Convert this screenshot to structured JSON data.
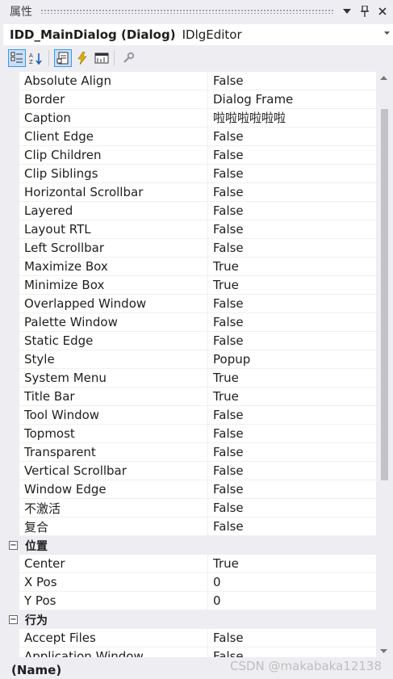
{
  "window": {
    "title": "属性",
    "dropdown_icon": "triangle-down-icon",
    "pin_icon": "pin-icon",
    "close_icon": "close-icon"
  },
  "object_selector": {
    "name": "IDD_MainDialog (Dialog)",
    "type": "IDlgEditor"
  },
  "toolbar": {
    "tools": [
      "categorized-icon",
      "alphabetical-icon",
      "properties-icon",
      "events-icon",
      "messages-icon",
      "property-pages-icon"
    ]
  },
  "groups": [
    {
      "category": null,
      "rows": [
        {
          "name": "Absolute Align",
          "value": "False"
        },
        {
          "name": "Border",
          "value": "Dialog Frame"
        },
        {
          "name": "Caption",
          "value": "啦啦啦啦啦啦"
        },
        {
          "name": "Client Edge",
          "value": "False"
        },
        {
          "name": "Clip Children",
          "value": "False"
        },
        {
          "name": "Clip Siblings",
          "value": "False"
        },
        {
          "name": "Horizontal Scrollbar",
          "value": "False"
        },
        {
          "name": "Layered",
          "value": "False"
        },
        {
          "name": "Layout RTL",
          "value": "False"
        },
        {
          "name": "Left Scrollbar",
          "value": "False"
        },
        {
          "name": "Maximize Box",
          "value": "True"
        },
        {
          "name": "Minimize Box",
          "value": "True"
        },
        {
          "name": "Overlapped Window",
          "value": "False"
        },
        {
          "name": "Palette Window",
          "value": "False"
        },
        {
          "name": "Static Edge",
          "value": "False"
        },
        {
          "name": "Style",
          "value": "Popup"
        },
        {
          "name": "System Menu",
          "value": "True"
        },
        {
          "name": "Title Bar",
          "value": "True"
        },
        {
          "name": "Tool Window",
          "value": "False"
        },
        {
          "name": "Topmost",
          "value": "False"
        },
        {
          "name": "Transparent",
          "value": "False"
        },
        {
          "name": "Vertical Scrollbar",
          "value": "False"
        },
        {
          "name": "Window Edge",
          "value": "False"
        },
        {
          "name": "不激活",
          "value": "False"
        },
        {
          "name": "复合",
          "value": "False"
        }
      ]
    },
    {
      "category": "位置",
      "toggle": "⊟",
      "rows": [
        {
          "name": "Center",
          "value": "True"
        },
        {
          "name": "X Pos",
          "value": "0"
        },
        {
          "name": "Y Pos",
          "value": "0"
        }
      ]
    },
    {
      "category": "行为",
      "toggle": "⊟",
      "rows": [
        {
          "name": "Accept Files",
          "value": "False"
        },
        {
          "name": "Application Window",
          "value": "False"
        }
      ]
    }
  ],
  "description": {
    "title": "(Name)"
  },
  "watermark": "CSDN @makabaka12138",
  "colors": {
    "selection_border": "#3399ff",
    "panel_bg": "#eeeef2"
  }
}
